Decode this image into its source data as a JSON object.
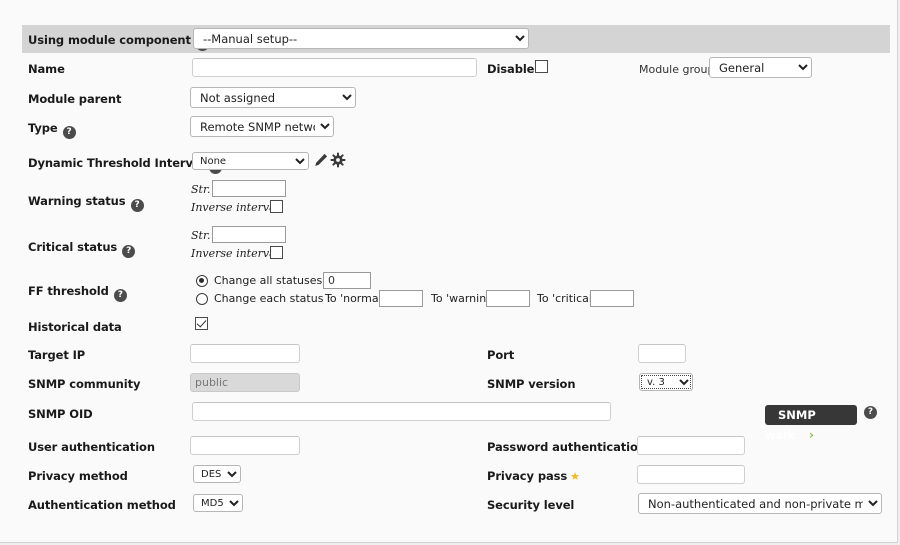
{
  "form": {
    "rows": {
      "using_module_component": {
        "label": "Using module component",
        "help": "?",
        "value": "--Manual setup--"
      },
      "name": {
        "label": "Name",
        "value": "",
        "placeholder": ""
      },
      "disabled": {
        "label": "Disabled",
        "checked": false
      },
      "module_group": {
        "label": "Module group",
        "value": "General"
      },
      "module_parent": {
        "label": "Module parent",
        "value": "Not assigned"
      },
      "type": {
        "label": "Type",
        "help": "?",
        "value": "Remote SNMP network"
      },
      "dynamic_threshold_interval": {
        "label": "Dynamic Threshold Interval",
        "help": "?",
        "value": "None"
      },
      "warning_status": {
        "label": "Warning status",
        "help": "?",
        "str_label": "Str.",
        "str_value": "",
        "inverse_label": "Inverse interval",
        "inverse_checked": false
      },
      "critical_status": {
        "label": "Critical status",
        "help": "?",
        "str_label": "Str.",
        "str_value": "",
        "inverse_label": "Inverse interval",
        "inverse_checked": false
      },
      "ff_threshold": {
        "label": "FF threshold",
        "help": "?",
        "change_all_label": "Change all statuses :",
        "change_all_selected": true,
        "change_all_value": "0",
        "change_each_label": "Change each status :",
        "change_each_selected": false,
        "to_normal_label": "To 'normal'",
        "to_normal_value": "",
        "to_warning_label": "To 'warning'",
        "to_warning_value": "",
        "to_critical_label": "To 'critical'",
        "to_critical_value": ""
      },
      "historical_data": {
        "label": "Historical data",
        "checked": true
      },
      "target_ip": {
        "label": "Target IP",
        "value": ""
      },
      "port": {
        "label": "Port",
        "value": ""
      },
      "snmp_community": {
        "label": "SNMP community",
        "value": "public",
        "disabled": true
      },
      "snmp_version": {
        "label": "SNMP version",
        "value": "v. 3"
      },
      "snmp_oid": {
        "label": "SNMP OID",
        "value": ""
      },
      "snmp_walk": {
        "label": "SNMP walk",
        "chevron": "›",
        "help": "?"
      },
      "user_authentication": {
        "label": "User authentication",
        "value": ""
      },
      "password_authentication": {
        "label": "Password authentication",
        "star": "★",
        "value": ""
      },
      "privacy_method": {
        "label": "Privacy method",
        "value": "DES"
      },
      "privacy_pass": {
        "label": "Privacy pass",
        "star": "★",
        "value": ""
      },
      "authentication_method": {
        "label": "Authentication method",
        "value": "MD5"
      },
      "security_level": {
        "label": "Security level",
        "value": "Non-authenticated and non-private method"
      }
    }
  },
  "colors": {
    "page_bg": "#fafafa",
    "band_bg": "#d4d4d4",
    "button_dark": "#373737",
    "chevron_green": "#8dc63f",
    "star_yellow": "#f3b81a"
  }
}
